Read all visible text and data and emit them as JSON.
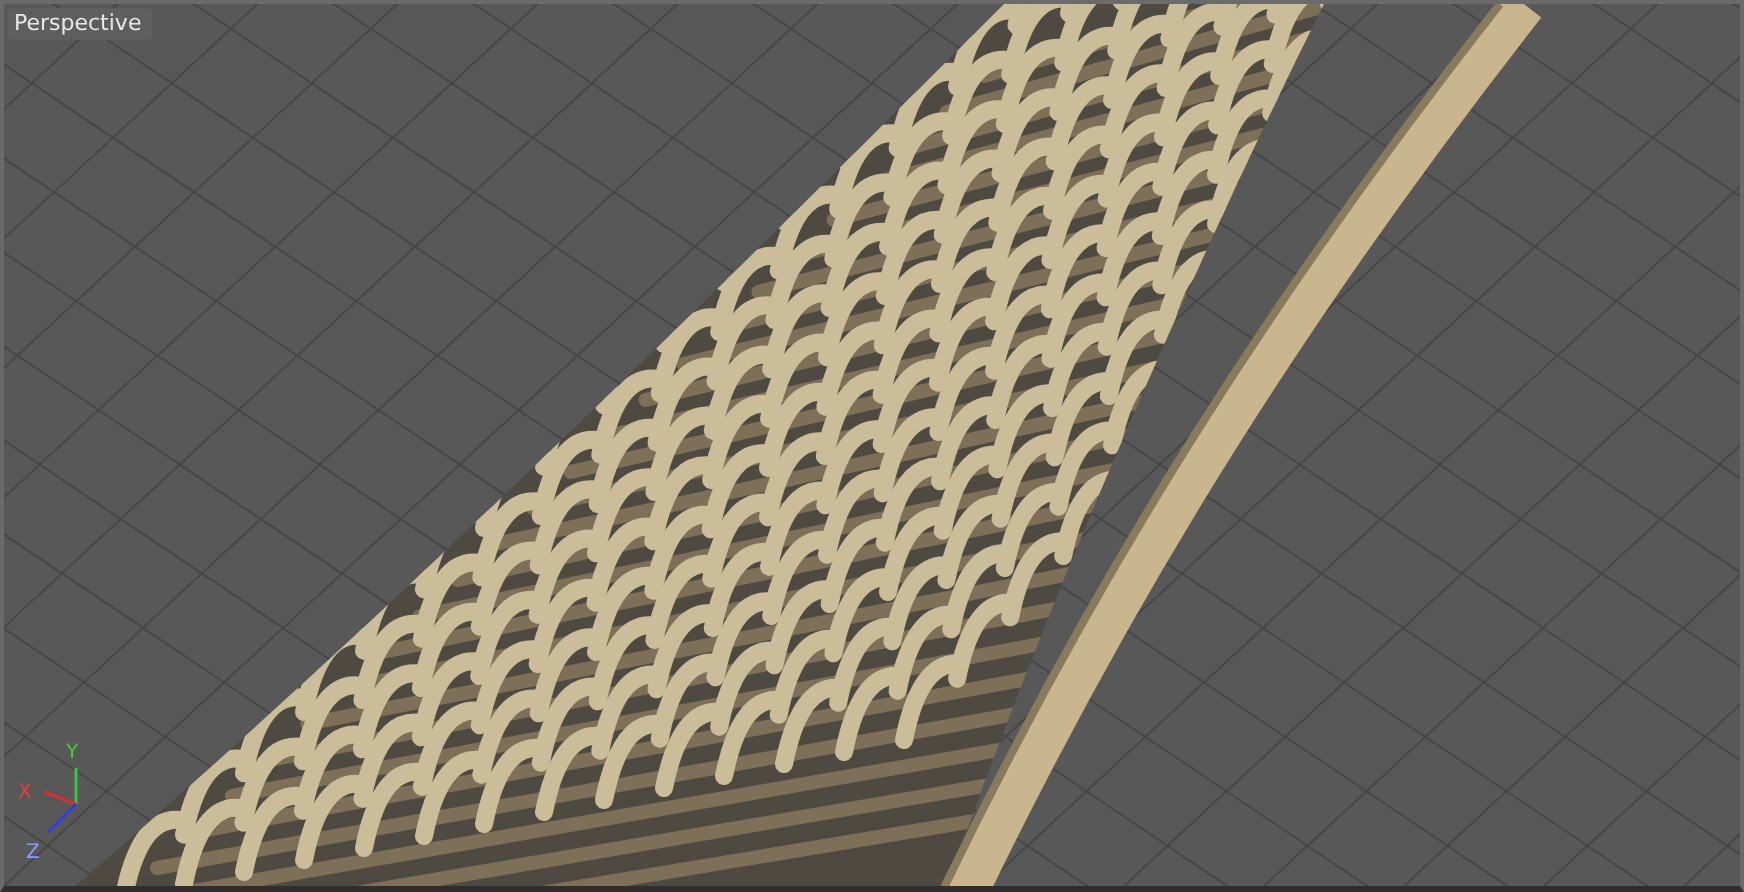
{
  "viewport": {
    "label": "Perspective"
  },
  "axis_gizmo": {
    "x_label": "X",
    "y_label": "Y",
    "z_label": "Z"
  }
}
